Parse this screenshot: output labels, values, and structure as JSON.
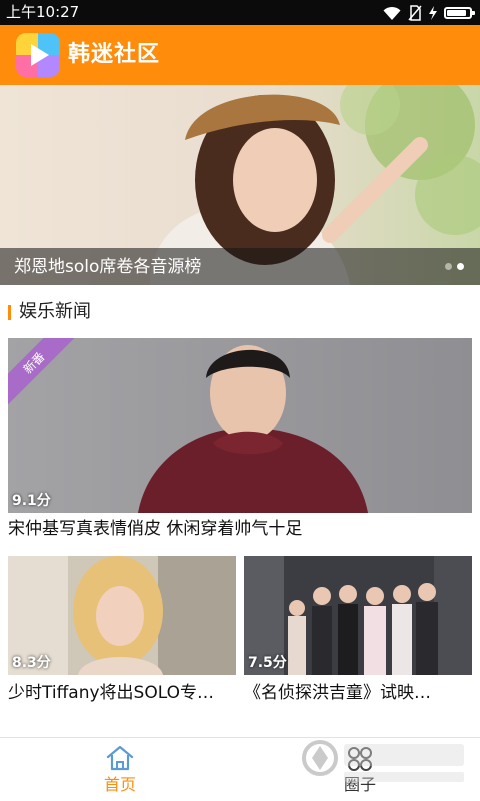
{
  "status_bar": {
    "time": "上午10:27",
    "icons": [
      "wifi-icon",
      "no-sim-icon",
      "charging-icon",
      "battery-icon"
    ],
    "battery_level": 0.85
  },
  "app_bar": {
    "title": "韩迷社区",
    "color": "#ff8c0a"
  },
  "banner": {
    "caption": "郑恩地solo席卷各音源榜",
    "slide_count": 2,
    "active_slide": 1
  },
  "section": {
    "title": "娱乐新闻",
    "accent": "#ff8c0a"
  },
  "feed": {
    "main": {
      "badge": "新番",
      "score": "9.1分",
      "title": "宋仲基写真表情俏皮 休闲穿着帅气十足"
    },
    "items": [
      {
        "score": "8.3分",
        "title": "少时Tiffany将出SOLO专…"
      },
      {
        "score": "7.5分",
        "title": "《名侦探洪吉童》试映…"
      }
    ]
  },
  "bottom_nav": {
    "items": [
      {
        "label": "首页",
        "icon": "home-icon",
        "active": true,
        "color": "#ff8c0a"
      },
      {
        "label": "圈子",
        "icon": "circle-icon",
        "active": false,
        "color": "#333333"
      }
    ]
  }
}
